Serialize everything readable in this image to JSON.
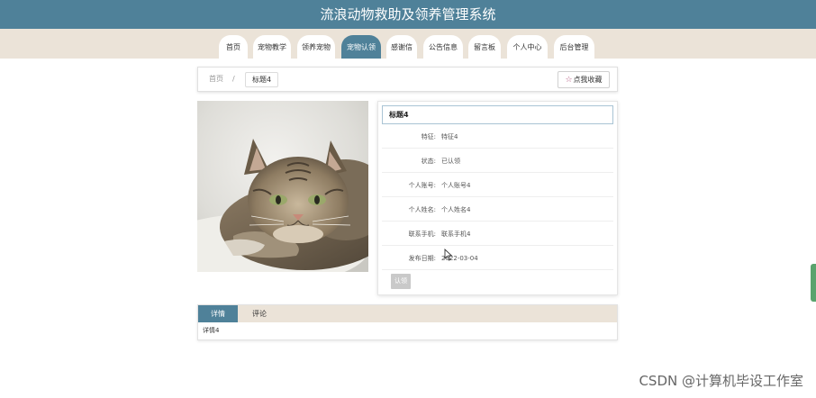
{
  "header": {
    "title": "流浪动物救助及领养管理系统"
  },
  "nav": {
    "items": [
      {
        "label": "首页",
        "active": false
      },
      {
        "label": "宠物教学",
        "active": false
      },
      {
        "label": "领养宠物",
        "active": false
      },
      {
        "label": "宠物认领",
        "active": true
      },
      {
        "label": "感谢信",
        "active": false
      },
      {
        "label": "公告信息",
        "active": false
      },
      {
        "label": "留言板",
        "active": false
      },
      {
        "label": "个人中心",
        "active": false
      },
      {
        "label": "后台管理",
        "active": false
      }
    ]
  },
  "breadcrumb": {
    "home": "首页",
    "separator": "/",
    "current": "标题4"
  },
  "favorite": {
    "label": "点我收藏",
    "icon": "star-outline-icon"
  },
  "pet_image": {
    "subject": "tabby-cat-lying-photo"
  },
  "detail": {
    "title": "标题4",
    "fields": [
      {
        "label": "特征:",
        "value": "特征4"
      },
      {
        "label": "状态:",
        "value": "已认领"
      },
      {
        "label": "个人账号:",
        "value": "个人账号4"
      },
      {
        "label": "个人姓名:",
        "value": "个人姓名4"
      },
      {
        "label": "联系手机:",
        "value": "联系手机4"
      },
      {
        "label": "发布日期:",
        "value": "2022-03-04"
      }
    ],
    "adopt_button": "认领"
  },
  "tabs": {
    "items": [
      {
        "label": "详情",
        "active": true
      },
      {
        "label": "评论",
        "active": false
      }
    ],
    "content": "详情4"
  },
  "watermark": "CSDN @计算机毕设工作室",
  "colors": {
    "primary": "#4f8199",
    "nav_bg": "#ebe3d8",
    "accent_star": "#b0507a",
    "scroll_handle": "#5aa36d"
  }
}
